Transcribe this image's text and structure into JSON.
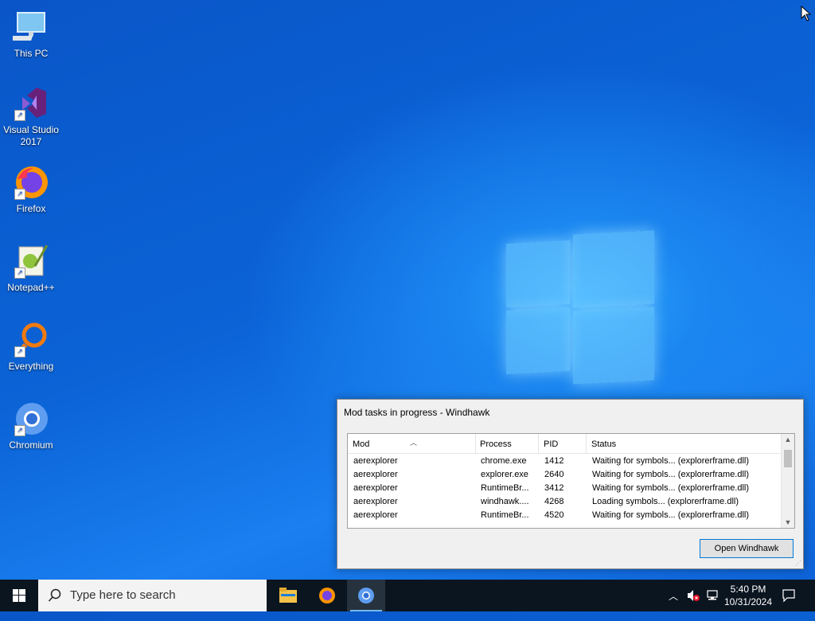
{
  "desktop": {
    "icons": [
      {
        "label": "This PC"
      },
      {
        "label": "Visual Studio 2017"
      },
      {
        "label": "Firefox"
      },
      {
        "label": "Notepad++"
      },
      {
        "label": "Everything"
      },
      {
        "label": "Chromium"
      }
    ]
  },
  "dialog": {
    "title": "Mod tasks in progress - Windhawk",
    "columns": [
      "Mod",
      "Process",
      "PID",
      "Status"
    ],
    "rows": [
      {
        "mod": "aerexplorer",
        "process": "chrome.exe",
        "pid": "1412",
        "status": "Waiting for symbols... (explorerframe.dll)"
      },
      {
        "mod": "aerexplorer",
        "process": "explorer.exe",
        "pid": "2640",
        "status": "Waiting for symbols... (explorerframe.dll)"
      },
      {
        "mod": "aerexplorer",
        "process": "RuntimeBr...",
        "pid": "3412",
        "status": "Waiting for symbols... (explorerframe.dll)"
      },
      {
        "mod": "aerexplorer",
        "process": "windhawk....",
        "pid": "4268",
        "status": "Loading symbols... (explorerframe.dll)"
      },
      {
        "mod": "aerexplorer",
        "process": "RuntimeBr...",
        "pid": "4520",
        "status": "Waiting for symbols... (explorerframe.dll)"
      }
    ],
    "button_label": "Open Windhawk"
  },
  "taskbar": {
    "search_placeholder": "Type here to search",
    "apps": [
      "file-explorer-icon",
      "firefox-icon",
      "chromium-icon"
    ],
    "clock_time": "5:40 PM",
    "clock_date": "10/31/2024"
  },
  "colors": {
    "accent": "#0078d7",
    "taskbar": "#0b1520"
  }
}
